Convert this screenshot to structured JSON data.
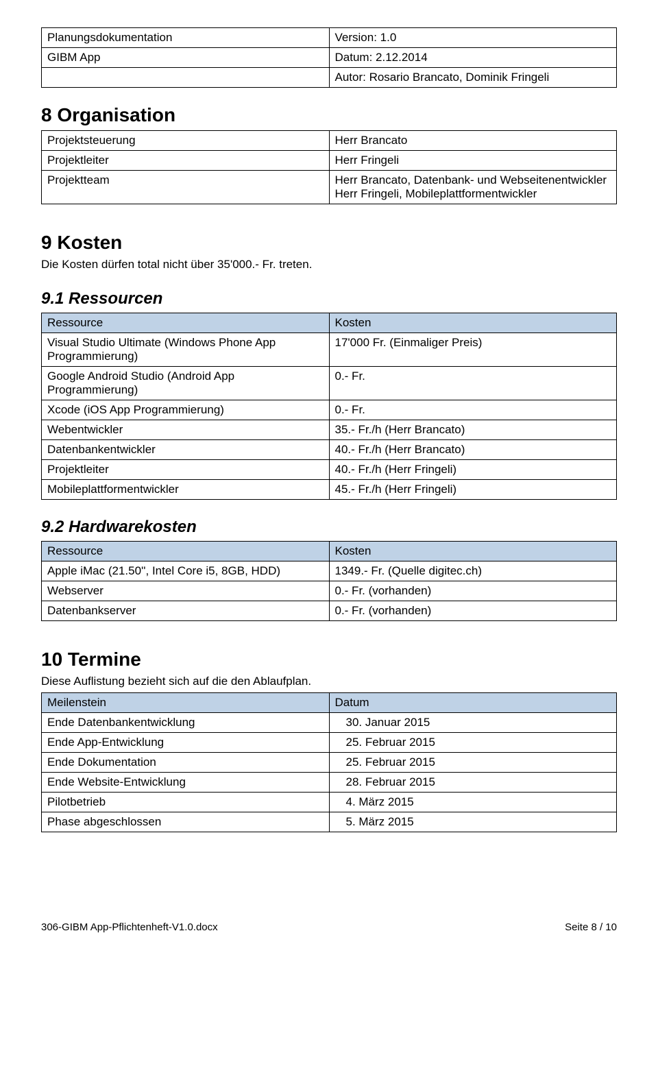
{
  "header": {
    "doc_title": "Planungsdokumentation",
    "version_label": "Version: 1.0",
    "app_name": "GIBM App",
    "date_label": "Datum: 2.12.2014",
    "author_label": "Autor: Rosario Brancato, Dominik Fringeli"
  },
  "sec8": {
    "title": "8  Organisation",
    "rows": [
      {
        "k": "Projektsteuerung",
        "v": "Herr Brancato"
      },
      {
        "k": "Projektleiter",
        "v": "Herr Fringeli"
      },
      {
        "k": "Projektteam",
        "v1": "Herr Brancato, Datenbank- und Webseitenentwickler",
        "v2": "Herr Fringeli, Mobileplattformentwickler"
      }
    ]
  },
  "sec9": {
    "title": "9  Kosten",
    "intro": "Die Kosten dürfen total nicht über 35'000.- Fr. treten."
  },
  "sec91": {
    "title": "9.1  Ressourcen",
    "head": {
      "c1": "Ressource",
      "c2": "Kosten"
    },
    "rows": [
      {
        "c1": "Visual Studio Ultimate (Windows Phone App Programmierung)",
        "c2": "17'000 Fr. (Einmaliger Preis)"
      },
      {
        "c1": "Google Android Studio (Android App Programmierung)",
        "c2": "0.- Fr."
      },
      {
        "c1": "Xcode (iOS App Programmierung)",
        "c2": "0.- Fr."
      },
      {
        "c1": "Webentwickler",
        "c2": "35.- Fr./h (Herr Brancato)"
      },
      {
        "c1": "Datenbankentwickler",
        "c2": "40.- Fr./h (Herr Brancato)"
      },
      {
        "c1": "Projektleiter",
        "c2": "40.- Fr./h (Herr Fringeli)"
      },
      {
        "c1": "Mobileplattformentwickler",
        "c2": "45.- Fr./h (Herr Fringeli)"
      }
    ]
  },
  "sec92": {
    "title": "9.2  Hardwarekosten",
    "head": {
      "c1": "Ressource",
      "c2": "Kosten"
    },
    "rows": [
      {
        "c1": "Apple iMac (21.50'', Intel Core i5, 8GB, HDD)",
        "c2": "1349.- Fr. (Quelle digitec.ch)"
      },
      {
        "c1": "Webserver",
        "c2": "0.- Fr. (vorhanden)"
      },
      {
        "c1": "Datenbankserver",
        "c2": "0.- Fr. (vorhanden)"
      }
    ]
  },
  "sec10": {
    "title": "10 Termine",
    "intro": "Diese Auflistung bezieht sich auf die den Ablaufplan.",
    "head": {
      "c1": "Meilenstein",
      "c2": "Datum"
    },
    "rows": [
      {
        "c1": "Ende Datenbankentwicklung",
        "c2": "30. Januar 2015"
      },
      {
        "c1": "Ende App-Entwicklung",
        "c2": "25. Februar 2015"
      },
      {
        "c1": "Ende Dokumentation",
        "c2": "25. Februar 2015"
      },
      {
        "c1": "Ende Website-Entwicklung",
        "c2": "28. Februar 2015"
      },
      {
        "c1": "Pilotbetrieb",
        "c2": "4. März 2015"
      },
      {
        "c1": "Phase abgeschlossen",
        "c2": "5. März 2015"
      }
    ]
  },
  "footer": {
    "left": "306-GIBM App-Pflichtenheft-V1.0.docx",
    "right": "Seite 8 / 10"
  }
}
